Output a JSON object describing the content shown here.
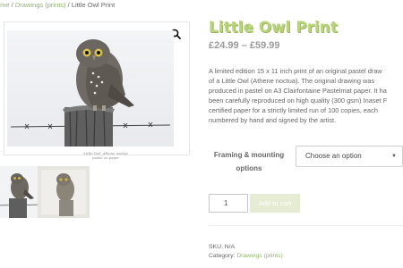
{
  "breadcrumb": {
    "home": "ome",
    "sep1": " / ",
    "category": "Drawings (prints)",
    "sep2": " / ",
    "current": "Little Owl Print"
  },
  "gallery": {
    "zoom_icon": "magnifier-icon",
    "image_caption_line1": "Little Owl, Athene noctua",
    "image_caption_line2": "pastel on paper"
  },
  "product": {
    "title": "Little Owl Print",
    "price": "£24.99 – £59.99",
    "description_lines": [
      "A limited edition 15 x 11 inch print of an original pastel draw",
      "of a Little Owl (Athene noctua). The original drawing was",
      "produced in pastel on A3 Clairfontaine Pastelmat paper. It ha",
      "been carefully reproduced on high quality (300 gsm) Inaset F",
      "certified paper for a strictly limited run of 100 copies, each",
      "numbered by hand and signed by the artist."
    ]
  },
  "options": {
    "label_line1": "Framing & mounting",
    "label_line2": "options",
    "select_value": "Choose an option"
  },
  "cart": {
    "quantity": "1",
    "add_label": "Add to cart"
  },
  "meta": {
    "sku_label": "SKU:",
    "sku_value": " N/A",
    "category_label": "Category:",
    "category_value": " Drawings (prints)"
  },
  "colors": {
    "accent_green": "#b9d27b",
    "link_green": "#8fb36a",
    "button_bg": "#e6ecd3"
  }
}
